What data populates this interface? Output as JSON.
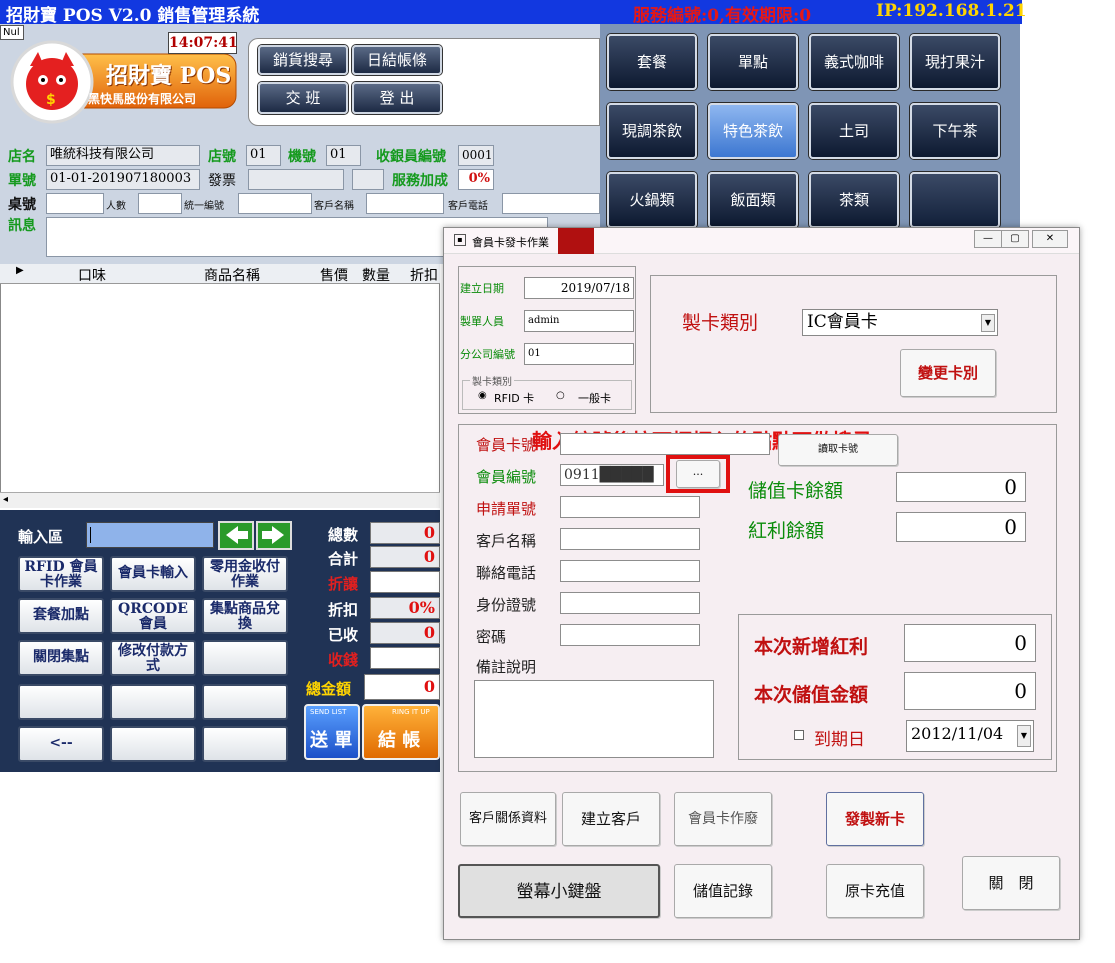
{
  "titlebar": {
    "app_title": "招財寶 POS V2.0 銷售管理系統",
    "service_info": "服務編號:0,有效期限:0",
    "ip": "IP:192.168.1.21"
  },
  "header": {
    "num_label": "Nul",
    "clock": "14:07:41",
    "logo_brand": "招財寶 POS",
    "logo_company": "黑快馬股份有限公司",
    "buttons": {
      "sales_search": "銷貨搜尋",
      "daily_close": "日結帳條",
      "shift_change": "交 班",
      "logout": "登 出"
    }
  },
  "info": {
    "store_name_label": "店名",
    "store_name": "唯統科技有限公司",
    "store_no_label": "店號",
    "store_no": "01",
    "machine_no_label": "機號",
    "machine_no": "01",
    "cashier_label": "收銀員編號",
    "cashier_no": "0001",
    "order_no_label": "單號",
    "order_no": "01-01-201907180003",
    "invoice_label": "發票",
    "service_label": "服務加成",
    "service_pct": "0%",
    "table_label": "桌號",
    "people_label": "人數",
    "tax_id_label": "統一編號",
    "customer_label": "客戶名稱",
    "phone_label": "客戶電話",
    "message_label": "訊息"
  },
  "products": [
    "套餐",
    "單點",
    "義式咖啡",
    "現打果汁",
    "現調茶飲",
    "特色茶飲",
    "土司",
    "下午茶",
    "火鍋類",
    "飯面類",
    "茶類",
    ""
  ],
  "order_table": {
    "columns": [
      "口味",
      "商品名稱",
      "售價",
      "數量",
      "折扣"
    ]
  },
  "input_area": {
    "label": "輸入區"
  },
  "keypad": [
    [
      "RFID 會員卡作業",
      "會員卡輸入",
      "零用金收付作業"
    ],
    [
      "套餐加點",
      "QRCODE會員",
      "集點商品兌換"
    ],
    [
      "關閉集點",
      "修改付款方式",
      ""
    ],
    [
      "",
      "",
      ""
    ],
    [
      "<--",
      "",
      ""
    ]
  ],
  "summary": {
    "count_label": "總數",
    "count_value": "0",
    "subtotal_label": "合計",
    "subtotal_value": "0",
    "discount_amt_label": "折讓",
    "discount_amt_value": "",
    "discount_label": "折扣",
    "discount_value": "0%",
    "received_label": "已收",
    "received_value": "0",
    "change_label": "收錢",
    "change_value": "",
    "total_label": "總金額",
    "total_value": "0",
    "send_label": "送 單",
    "send_sub": "SEND LIST",
    "checkout_label": "結 帳",
    "checkout_sub": "RING IT UP"
  },
  "dialog": {
    "title": "會員卡發卡作業",
    "create_date_label": "建立日期",
    "create_date": "2019/07/18",
    "creator_label": "製單人員",
    "creator": "admin",
    "branch_label": "分公司編號",
    "branch": "01",
    "card_kind_group": "製卡類別",
    "radio_rfid": "RFID 卡",
    "radio_normal": "一般卡",
    "card_type_label": "製卡類別",
    "card_type_value": "IC會員卡",
    "change_card_btn": "變更卡別",
    "annotation": "輸入編號後按下框框內的點點可做搜尋",
    "member_card_no_label": "會員卡號",
    "read_card_btn": "讀取卡號",
    "member_no_label": "會員編號",
    "member_no": "0911█████",
    "browse_btn": "...",
    "apply_no_label": "申請單號",
    "customer_name_label": "客戶名稱",
    "phone_label": "聯絡電話",
    "id_label": "身份證號",
    "password_label": "密碼",
    "remarks_label": "備註說明",
    "stored_balance_label": "儲值卡餘額",
    "stored_balance": "0",
    "bonus_balance_label": "紅利餘額",
    "bonus_balance": "0",
    "new_bonus_label": "本次新增紅利",
    "new_bonus": "0",
    "new_stored_label": "本次儲值金額",
    "new_stored": "0",
    "expiry_label": "到期日",
    "expiry_date": "2012/11/04",
    "buttons": {
      "customer_relation": "客戶關係資料",
      "create_customer": "建立客戶",
      "void_card": "會員卡作廢",
      "issue_card": "發製新卡",
      "keyboard": "螢幕小鍵盤",
      "stored_record": "儲值記錄",
      "recharge": "原卡充值",
      "close": "關　閉"
    },
    "colors": {
      "highlight_box": "#e01010",
      "annotation": "#e01010"
    }
  }
}
